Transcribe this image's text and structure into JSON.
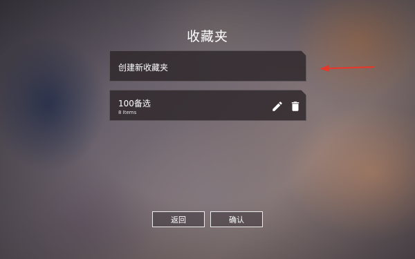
{
  "page": {
    "title": "收藏夹"
  },
  "create_panel": {
    "label": "创建新收藏夹"
  },
  "favorites": [
    {
      "name": "100备选",
      "count": "8 Items",
      "actions": {
        "edit_icon": "pencil-icon",
        "delete_icon": "trash-icon"
      }
    }
  ],
  "annotation": {
    "arrow_color": "#e4392a"
  },
  "footer": {
    "back_label": "返回",
    "confirm_label": "确认"
  }
}
